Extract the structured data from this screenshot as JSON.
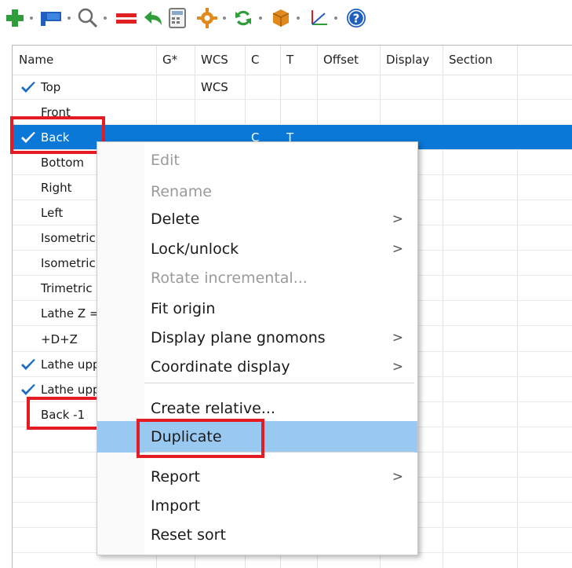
{
  "toolbar": {
    "icons": [
      "plus-icon",
      "flag-icon",
      "magnifier-icon",
      "equals-icon",
      "undo-icon",
      "calculator-icon",
      "gear-icon",
      "refresh-icon",
      "box-icon",
      "axes-icon",
      "help-icon"
    ],
    "colors": {
      "green": "#2e9d3a",
      "blue": "#1f5fbf",
      "red": "#e02020",
      "orange": "#e08a1e"
    }
  },
  "table": {
    "columns": [
      "Name",
      "G*",
      "WCS",
      "C",
      "T",
      "Offset",
      "Display",
      "Section"
    ],
    "rows": [
      {
        "name": "Top",
        "checked": true,
        "g": "",
        "wcs": "WCS",
        "c": "",
        "t": ""
      },
      {
        "name": "Front",
        "checked": false,
        "g": "",
        "wcs": "",
        "c": "",
        "t": ""
      },
      {
        "name": "Back",
        "checked": true,
        "g": "",
        "wcs": "",
        "c": "C",
        "t": "T",
        "selected": true
      },
      {
        "name": "Bottom",
        "checked": false,
        "g": "",
        "wcs": "",
        "c": "",
        "t": ""
      },
      {
        "name": "Right",
        "checked": false,
        "g": "",
        "wcs": "",
        "c": "",
        "t": ""
      },
      {
        "name": "Left",
        "checked": false,
        "g": "",
        "wcs": "",
        "c": "",
        "t": ""
      },
      {
        "name": "Isometric",
        "checked": false,
        "g": "",
        "wcs": "",
        "c": "",
        "t": ""
      },
      {
        "name": "Isometric",
        "checked": false,
        "g": "",
        "wcs": "",
        "c": "",
        "t": ""
      },
      {
        "name": "Trimetric",
        "checked": false,
        "g": "",
        "wcs": "",
        "c": "",
        "t": ""
      },
      {
        "name": "Lathe Z =",
        "checked": false,
        "g": "",
        "wcs": "",
        "c": "",
        "t": ""
      },
      {
        "name": "+D+Z",
        "checked": false,
        "g": "",
        "wcs": "",
        "c": "",
        "t": ""
      },
      {
        "name": "Lathe upp",
        "checked": true,
        "g": "",
        "wcs": "",
        "c": "",
        "t": ""
      },
      {
        "name": "Lathe upp",
        "checked": true,
        "g": "",
        "wcs": "",
        "c": "",
        "t": ""
      },
      {
        "name": "Back -1",
        "checked": false,
        "g": "",
        "wcs": "",
        "c": "",
        "t": ""
      }
    ],
    "selected_color": "#0a78d7",
    "check_color": "#1a6fc4"
  },
  "context_menu": {
    "items": [
      {
        "label": "Edit",
        "disabled": true,
        "submenu": false
      },
      {
        "label": "Rename",
        "disabled": true,
        "submenu": false
      },
      {
        "label": "Delete",
        "disabled": false,
        "submenu": true
      },
      {
        "label": "Lock/unlock",
        "disabled": false,
        "submenu": true
      },
      {
        "label": "Rotate incremental...",
        "disabled": true,
        "submenu": false
      },
      {
        "label": "Fit origin",
        "disabled": false,
        "submenu": false
      },
      {
        "label": "Display plane gnomons",
        "disabled": false,
        "submenu": true
      },
      {
        "label": "Coordinate display",
        "disabled": false,
        "submenu": true
      },
      {
        "label": "Create relative...",
        "disabled": false,
        "submenu": false
      },
      {
        "label": "Duplicate",
        "disabled": false,
        "submenu": false,
        "highlighted": true
      },
      {
        "label": "Report",
        "disabled": false,
        "submenu": true
      },
      {
        "label": "Import",
        "disabled": false,
        "submenu": false
      },
      {
        "label": "Reset sort",
        "disabled": false,
        "submenu": false
      }
    ],
    "submenu_arrow": ">",
    "hover_color": "#99c9f1"
  },
  "annotation": {
    "highlight_color": "#e31b23"
  }
}
